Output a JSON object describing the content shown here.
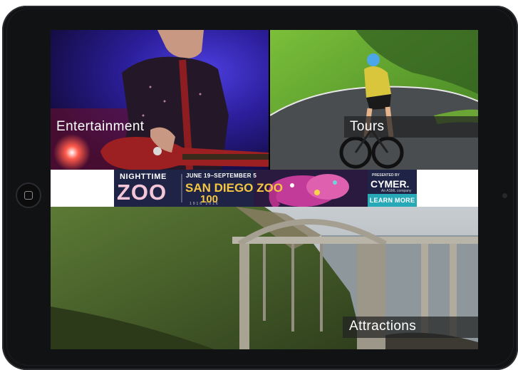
{
  "tiles": {
    "entertainment": {
      "label": "Entertainment"
    },
    "tours": {
      "label": "Tours"
    },
    "attractions": {
      "label": "Attractions"
    }
  },
  "ad": {
    "headline_top": "NIGHTTIME",
    "headline_main": "ZOO",
    "dates": "JUNE 19–SEPTEMBER 5",
    "brand": "SAN DIEGO ZOO",
    "anniversary": "100",
    "years": "1916  2016",
    "presented_by": "PRESENTED BY",
    "sponsor": "CYMER.",
    "sponsor_sub": "An ASML company",
    "cta": "LEARN MORE"
  },
  "colors": {
    "device_body": "#111214",
    "label_bg": "#232323",
    "ad_bg": "#1f2447",
    "ad_accent": "#f6c642",
    "cta_bg": "#27a9b8"
  },
  "icons": [
    "home-button-icon",
    "front-camera-icon"
  ]
}
